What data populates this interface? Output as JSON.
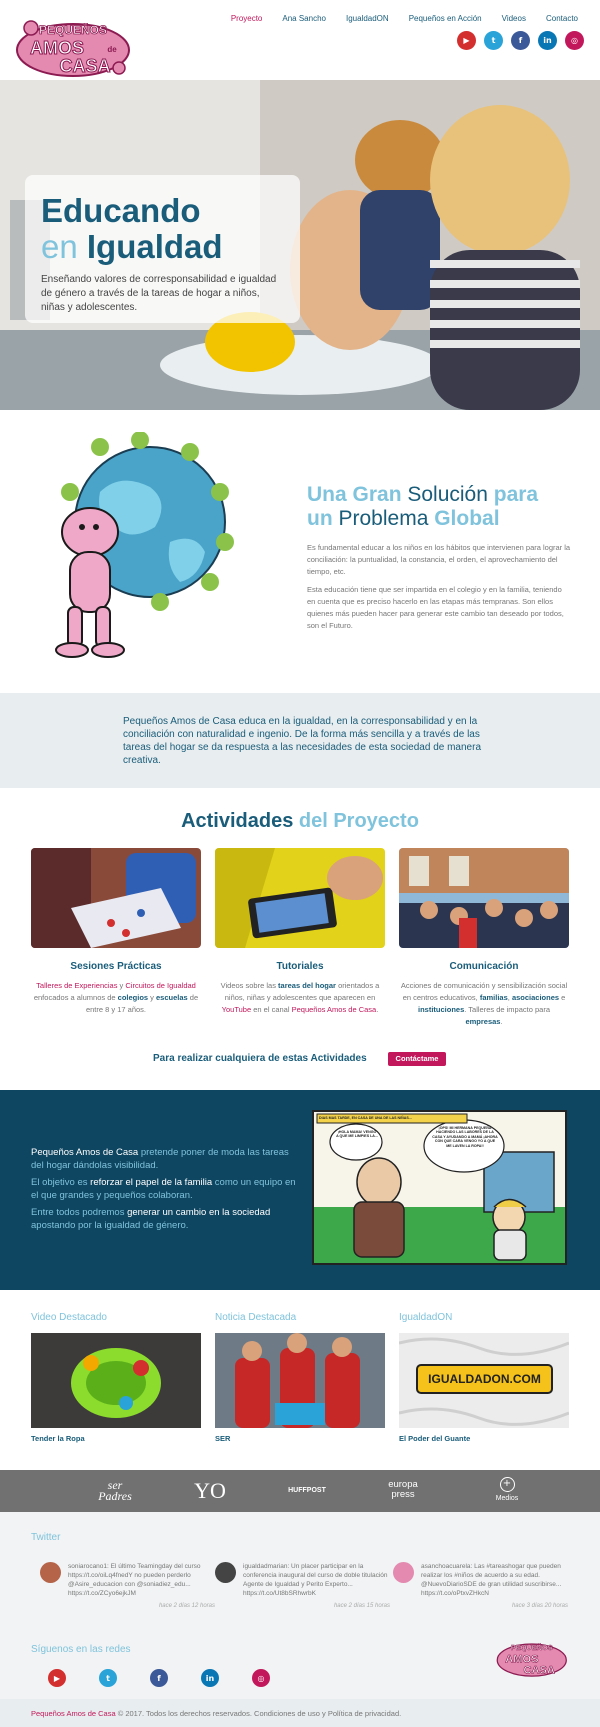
{
  "brand": {
    "logo_text": "PEQUEÑOS AMOS DE CASA",
    "colors": {
      "pink": "#c2185b",
      "dark_blue": "#1a5d7a",
      "light_blue": "#7fc3dc",
      "navy_band": "#0e4560"
    }
  },
  "nav": {
    "items": [
      {
        "label": "Proyecto",
        "active": true
      },
      {
        "label": "Ana Sancho",
        "active": false
      },
      {
        "label": "IgualdadON",
        "active": false
      },
      {
        "label": "Pequeños en Acción",
        "active": false
      },
      {
        "label": "Videos",
        "active": false
      },
      {
        "label": "Contacto",
        "active": false
      }
    ]
  },
  "social": {
    "youtube": {
      "icon": "youtube-icon",
      "glyph": "▶",
      "color": "#d32f2f"
    },
    "twitter": {
      "icon": "twitter-icon",
      "glyph": "t",
      "color": "#29a3d8"
    },
    "facebook": {
      "icon": "facebook-icon",
      "glyph": "f",
      "color": "#3b5998"
    },
    "linkedin": {
      "icon": "linkedin-icon",
      "glyph": "in",
      "color": "#0a77b5"
    },
    "instagram": {
      "icon": "instagram-icon",
      "glyph": "◎",
      "color": "#c2185b"
    }
  },
  "hero": {
    "title_line1": "Educando",
    "title_en": "en",
    "title_igualdad": "Igualdad",
    "subtitle": "Enseñando valores de corresponsabilidad e igualdad de género a través de la tareas de hogar a niños, niñas y adolescentes."
  },
  "global": {
    "title_parts": [
      "Una Gran ",
      "Solución",
      " para ",
      "un ",
      "Problema",
      " Global"
    ],
    "p1": "Es fundamental educar a los niños en los hábitos que intervienen para lograr la conciliación: la puntualidad, la constancia, el orden, el aprovechamiento del tiempo, etc.",
    "p2": "Esta educación tiene que ser impartida en el colegio y en la familia, teniendo en cuenta que es preciso hacerlo en las etapas más tempranas. Son ellos quienes más pueden hacer para generar este cambio tan deseado por todos, son el Futuro."
  },
  "quote": {
    "text": "Pequeños Amos de Casa educa en la igualdad, en la corresponsabilidad y en la conciliación con naturalidad e ingenio. De la forma más sencilla y a través de las tareas del hogar se da respuesta a las necesidades de esta sociedad de manera creativa."
  },
  "activities": {
    "title_main": "Actividades",
    "title_light": " del Proyecto",
    "items": [
      {
        "name": "Sesiones Prácticas",
        "parts": [
          [
            "pk",
            "Talleres de Experiencias"
          ],
          [
            "n",
            " y "
          ],
          [
            "pk",
            "Circuitos de Igualdad"
          ],
          [
            "n",
            " enfocados a alumnos de "
          ],
          [
            "bl",
            "colegios"
          ],
          [
            "n",
            " y "
          ],
          [
            "bl",
            "escuelas"
          ],
          [
            "n",
            " de entre 8 y 17 años."
          ]
        ]
      },
      {
        "name": "Tutoriales",
        "parts": [
          [
            "n",
            "Videos sobre las "
          ],
          [
            "bl",
            "tareas del hogar"
          ],
          [
            "n",
            " orientados a niños, niñas y adolescentes que aparecen en "
          ],
          [
            "pk",
            "YouTube"
          ],
          [
            "n",
            " en el canal "
          ],
          [
            "pk",
            "Pequeños Amos de Casa"
          ],
          [
            "n",
            "."
          ]
        ]
      },
      {
        "name": "Comunicación",
        "parts": [
          [
            "n",
            "Acciones de comunicación y sensibilización social en centros educativos, "
          ],
          [
            "bl",
            "familias"
          ],
          [
            "n",
            ", "
          ],
          [
            "bl",
            "asociaciones"
          ],
          [
            "n",
            " e "
          ],
          [
            "bl",
            "instituciones"
          ],
          [
            "n",
            ". Talleres de impacto para "
          ],
          [
            "bl",
            "empresas"
          ],
          [
            "n",
            "."
          ]
        ]
      }
    ],
    "cta_text": "Para realizar cualquiera de estas Actividades",
    "cta_button": "Contáctame"
  },
  "mission": {
    "paragraphs": [
      [
        [
          "w",
          "Pequeños Amos de Casa"
        ],
        [
          "n",
          " pretende poner de moda las tareas del hogar dándolas visibilidad."
        ]
      ],
      [
        [
          "n",
          "El objetivo es "
        ],
        [
          "w",
          "reforzar el papel de la familia"
        ],
        [
          "n",
          " como un equipo en el que grandes y pequeños colaboran."
        ]
      ],
      [
        [
          "n",
          "Entre todos podremos "
        ],
        [
          "w",
          "generar un cambio en la sociedad"
        ],
        [
          "n",
          " apostando por la igualdad de género."
        ]
      ]
    ],
    "comic": {
      "caption": "DIAS MAS TARDE, EN CASA DE UNA DE LAS NIÑAS...",
      "bubble1": "¡HOLA MAMA! VENGO A QUE ME LIMPIES LA...",
      "bubble2": "¡OPS! MI HERMANA PEQUEÑA HACIENDO LAS LABORES DE LA CASA Y AYUDANDO A MAMÁ ¡AHORA CON QUE CARA VENGO YO A QUE ME LAVEN LA ROPA!!"
    }
  },
  "featured": [
    {
      "heading": "Video Destacado",
      "caption": "Tender la Ropa"
    },
    {
      "heading": "Noticia Destacada",
      "caption": "SER"
    },
    {
      "heading": "IgualdadON",
      "caption": "El Poder del Guante",
      "banner": "IGUALDADON.COM"
    }
  ],
  "media": {
    "logos": [
      "ser Padres",
      "YO",
      "HUFFPOST",
      "europa press"
    ],
    "more_label": "Medios",
    "more_glyph": "+"
  },
  "twitter": {
    "heading": "Twitter",
    "tweets": [
      {
        "text": "soniarocano1: El último Teamingday del curso https://t.co/oiLq4fnedY no pueden perderlo @Asire_educacion con @soniadiez_edu... https://t.co/ZCyo6ejkJM",
        "time": "hace 2 días 12 horas",
        "avatar_color": "#b5644a"
      },
      {
        "text": "igualdadmarian: Un placer participar en la conferencia inaugural del curso de doble titulación Agente de Igualdad y Perito Experto... https://t.co/Ut8bSRhwrbK",
        "time": "hace 2 días 15 horas",
        "avatar_color": "#444444"
      },
      {
        "text": "asanchoacuarela: Las #tareashogar que pueden realizar los #niños de acuerdo a su edad. @NuevoDiarioSDE de gran utilidad suscribirse... https://t.co/oPtxvZHkcN",
        "time": "hace 3 días 20 horas",
        "avatar_color": "#e48ab0"
      }
    ]
  },
  "follow": {
    "heading": "Síguenos en las redes"
  },
  "footer": {
    "brand": "Pequeños Amos de Casa",
    "text": " © 2017. Todos los derechos reservados. Condiciones de uso y Política de privacidad."
  }
}
